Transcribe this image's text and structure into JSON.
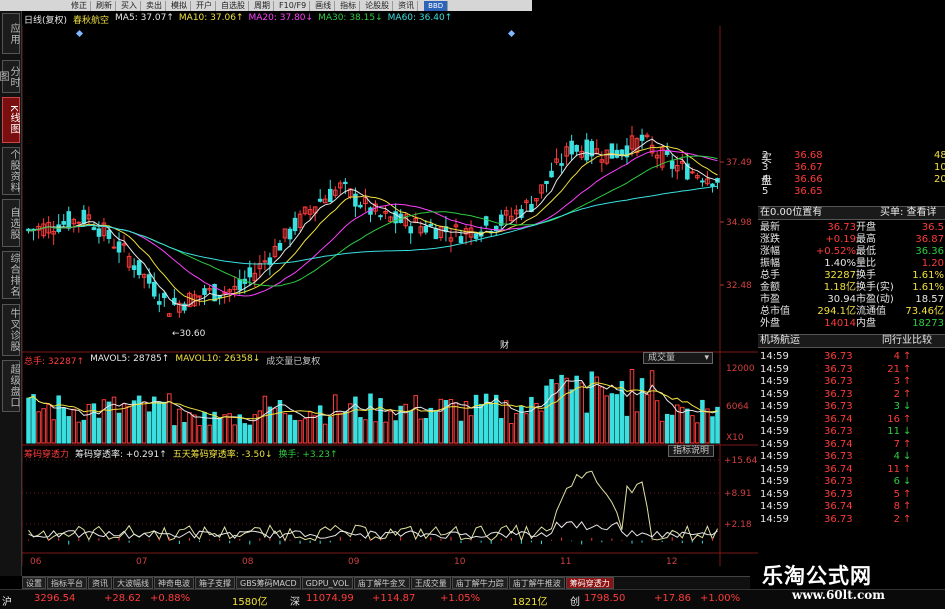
{
  "toolbar": {
    "items": [
      "修正",
      "刷新",
      "买入",
      "卖出",
      "模拟",
      "开户",
      "自选股",
      "周期",
      "F10/F9",
      "画线",
      "指标",
      "论股股",
      "资讯"
    ],
    "logo": "BBD"
  },
  "left_tabs": [
    "应用",
    "分时图",
    "K线图",
    "个股资料",
    "自选股",
    "综合排名",
    "牛叉诊股",
    "超级盘口"
  ],
  "header": {
    "title": "日线(复权)",
    "stock": "春秋航空",
    "ma": [
      {
        "label": "MA5: 37.07↑",
        "color": "#e8e8e8"
      },
      {
        "label": "MA10: 37.06↑",
        "color": "#f0e040"
      },
      {
        "label": "MA20: 37.80↓",
        "color": "#ff40ff"
      },
      {
        "label": "MA30: 38.15↓",
        "color": "#2ecc40"
      },
      {
        "label": "MA60: 36.40↑",
        "color": "#3ae0e0"
      }
    ]
  },
  "price_axis": {
    "labels": [
      "37.49",
      "34.98",
      "32.48"
    ],
    "low_label": "30.60",
    "marker": "财"
  },
  "volume": {
    "header": [
      {
        "label": "总手: 32287↑",
        "color": "#ff3b3b"
      },
      {
        "label": "MAVOL5: 28785↑",
        "color": "#e8e8e8"
      },
      {
        "label": "MAVOL10: 26358↓",
        "color": "#f0e040"
      },
      {
        "label": "成交量已复权",
        "color": "#c8c8c8"
      }
    ],
    "button": "成交量",
    "axis": [
      "12000",
      "6064",
      "X10"
    ]
  },
  "indicator": {
    "header": [
      {
        "label": "筹码穿透力",
        "color": "#ff3b3b"
      },
      {
        "label": "筹码穿透率: +0.291↑",
        "color": "#e8e8e8"
      },
      {
        "label": "五天筹码穿透率: -3.50↓",
        "color": "#f0e040"
      },
      {
        "label": "换手: +3.23↑",
        "color": "#2ecc40"
      }
    ],
    "button": "指标说明",
    "axis": [
      "15.64",
      "8.91",
      "2.18"
    ]
  },
  "date_axis": [
    "06",
    "07",
    "08",
    "09",
    "10",
    "11",
    "12"
  ],
  "orderbook": [
    {
      "label": "2",
      "price": "36.68",
      "vol": "48"
    },
    {
      "label": "3",
      "price": "36.67",
      "vol": "10"
    },
    {
      "label": "4",
      "price": "36.66",
      "vol": "20"
    },
    {
      "label": "5",
      "price": "36.65",
      "vol": ""
    }
  ],
  "orderbook_side": "买盘",
  "position_bar": {
    "left": "在0.00位置有",
    "right": "买单: 查看详"
  },
  "quote_rows": [
    {
      "l1": "最新",
      "v1": "36.73",
      "c1": "#ff3b3b",
      "l2": "开盘",
      "v2": "36.5",
      "c2": "#ff3b3b"
    },
    {
      "l1": "涨跌",
      "v1": "+0.19",
      "c1": "#ff3b3b",
      "l2": "最高",
      "v2": "36.87",
      "c2": "#ff3b3b"
    },
    {
      "l1": "涨幅",
      "v1": "+0.52%",
      "c1": "#ff3b3b",
      "l2": "最低",
      "v2": "36.36",
      "c2": "#2ecc40"
    },
    {
      "l1": "振幅",
      "v1": "1.40%",
      "c1": "#e8e8e8",
      "l2": "量比",
      "v2": "1.20",
      "c2": "#ff3b3b"
    },
    {
      "l1": "总手",
      "v1": "32287",
      "c1": "#f0e040",
      "l2": "换手",
      "v2": "1.61%",
      "c2": "#f0e040"
    },
    {
      "l1": "金额",
      "v1": "1.18亿",
      "c1": "#f0e040",
      "l2": "换手(实)",
      "v2": "1.61%",
      "c2": "#f0e040"
    },
    {
      "l1": "市盈",
      "v1": "30.94",
      "c1": "#e8e8e8",
      "l2": "市盈(动)",
      "v2": "18.57",
      "c2": "#e8e8e8"
    },
    {
      "l1": "总市值",
      "v1": "294.1亿",
      "c1": "#f0e040",
      "l2": "流通值",
      "v2": "73.46亿",
      "c2": "#f0e040"
    },
    {
      "l1": "外盘",
      "v1": "14014",
      "c1": "#ff3b3b",
      "l2": "内盘",
      "v2": "18273",
      "c2": "#2ecc40"
    }
  ],
  "trade_header": {
    "left": "机场航运",
    "right": "同行业比较"
  },
  "trades": [
    {
      "time": "14:59",
      "price": "36.73",
      "vol": "4",
      "dir": "up"
    },
    {
      "time": "14:59",
      "price": "36.73",
      "vol": "21",
      "dir": "up"
    },
    {
      "time": "14:59",
      "price": "36.73",
      "vol": "3",
      "dir": "up"
    },
    {
      "time": "14:59",
      "price": "36.73",
      "vol": "2",
      "dir": "up"
    },
    {
      "time": "14:59",
      "price": "36.73",
      "vol": "3",
      "dir": "down"
    },
    {
      "time": "14:59",
      "price": "36.74",
      "vol": "16",
      "dir": "up"
    },
    {
      "time": "14:59",
      "price": "36.73",
      "vol": "11",
      "dir": "down"
    },
    {
      "time": "14:59",
      "price": "36.74",
      "vol": "7",
      "dir": "up"
    },
    {
      "time": "14:59",
      "price": "36.73",
      "vol": "4",
      "dir": "down"
    },
    {
      "time": "14:59",
      "price": "36.74",
      "vol": "11",
      "dir": "up"
    },
    {
      "time": "14:59",
      "price": "36.73",
      "vol": "6",
      "dir": "down"
    },
    {
      "time": "14:59",
      "price": "36.73",
      "vol": "5",
      "dir": "up"
    },
    {
      "time": "14:59",
      "price": "36.74",
      "vol": "8",
      "dir": "up"
    },
    {
      "time": "14:59",
      "price": "36.73",
      "vol": "2",
      "dir": "up"
    }
  ],
  "bottom_tabs": [
    "设置",
    "指标平台",
    "资讯",
    "大波幅线",
    "神奇电波",
    "箱子支撑",
    "GBS筹码MACD",
    "GDPU_VOL",
    "庙丁解牛金叉",
    "王成交量",
    "庙丁解牛力踪",
    "庙丁解牛推波",
    "筹码穿透力"
  ],
  "bottom_active": 12,
  "status": [
    {
      "label": "沪",
      "color": "#e8e8e8"
    },
    {
      "label": "3296.54",
      "color": "#ff3b3b"
    },
    {
      "label": "+28.62",
      "color": "#ff3b3b"
    },
    {
      "label": "+0.88%",
      "color": "#ff3b3b"
    },
    {
      "label": "1580亿",
      "color": "#f0e040"
    },
    {
      "label": "深",
      "color": "#e8e8e8"
    },
    {
      "label": "11074.99",
      "color": "#ff3b3b"
    },
    {
      "label": "+114.87",
      "color": "#ff3b3b"
    },
    {
      "label": "+1.05%",
      "color": "#ff3b3b"
    },
    {
      "label": "1821亿",
      "color": "#f0e040"
    },
    {
      "label": "创",
      "color": "#e8e8e8"
    },
    {
      "label": "1798.50",
      "color": "#ff3b3b"
    },
    {
      "label": "+17.86",
      "color": "#ff3b3b"
    },
    {
      "label": "+1.00%",
      "color": "#ff3b3b"
    }
  ],
  "watermark": {
    "line1": "乐淘公式网",
    "line2": "www.60lt.com"
  }
}
